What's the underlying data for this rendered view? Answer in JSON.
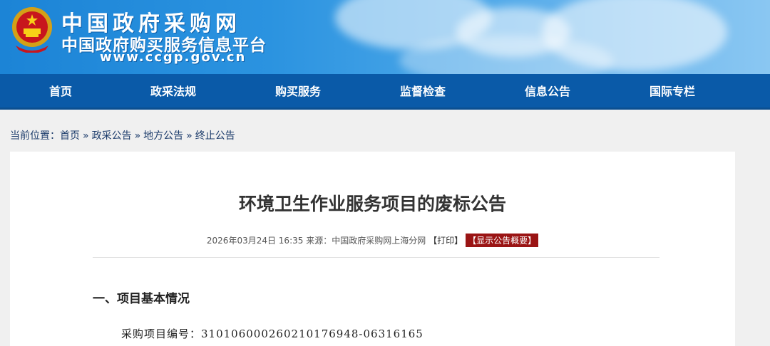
{
  "header": {
    "title_line1": "中国政府采购网",
    "title_line2": "中国政府购买服务信息平台",
    "url": "www.ccgp.gov.cn",
    "emblem_icon": "national-emblem-icon"
  },
  "nav": {
    "items": [
      {
        "label": "首页"
      },
      {
        "label": "政采法规"
      },
      {
        "label": "购买服务"
      },
      {
        "label": "监督检查"
      },
      {
        "label": "信息公告"
      },
      {
        "label": "国际专栏"
      }
    ]
  },
  "breadcrumb": {
    "prefix": "当前位置：",
    "items": [
      "首页",
      "政采公告",
      "地方公告",
      "终止公告"
    ],
    "separator": "»"
  },
  "article": {
    "title": "环境卫生作业服务项目的废标公告",
    "meta_date": "2026年03月24日 16:35",
    "meta_source": "来源：中国政府采购网上海分网",
    "print_label": "【打印】",
    "summary_label": "【显示公告概要】",
    "section1_heading": "一、项目基本情况",
    "project_number": "采购项目编号：310106000260210176948-06316165"
  },
  "colors": {
    "nav_bg": "#0a5aa8",
    "summary_bg": "#9a1414",
    "banner_blue": "#1c84d6"
  }
}
